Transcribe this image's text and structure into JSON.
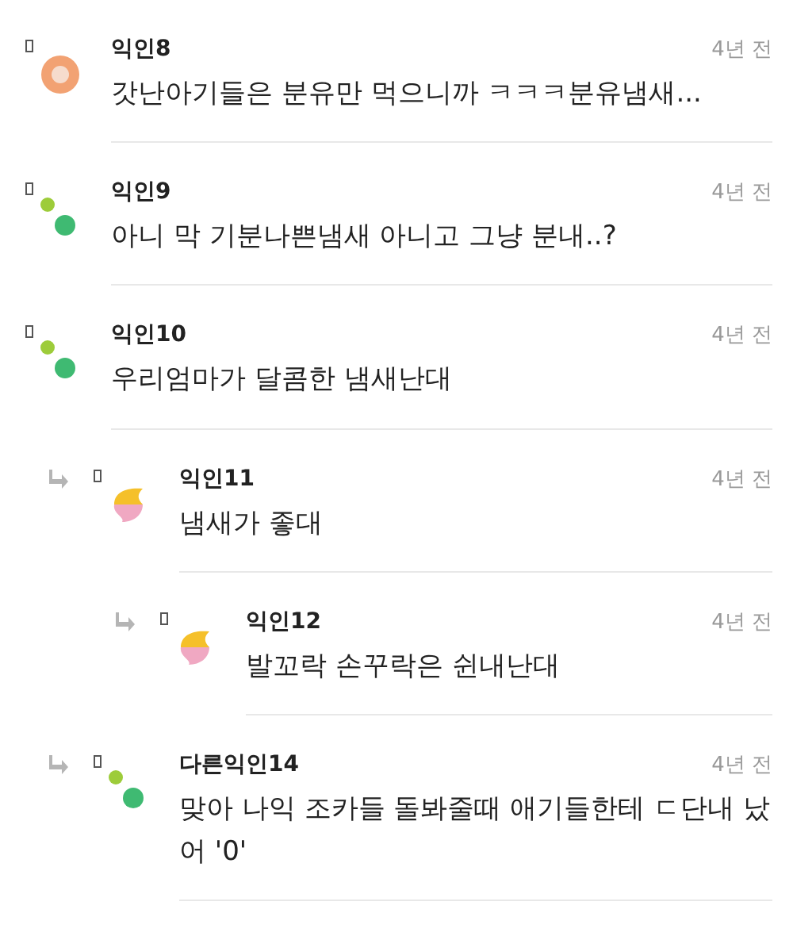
{
  "comments": [
    {
      "author": "익인8",
      "time": "4년 전",
      "text": "갓난아기들은 분유만 먹으니까 ㅋㅋㅋ분유냄새...",
      "kind": "ring"
    },
    {
      "author": "익인9",
      "time": "4년 전",
      "text": "아니 막 기분나쁜냄새 아니고 그냥 분내..?",
      "kind": "dots"
    },
    {
      "author": "익인10",
      "time": "4년 전",
      "text": "우리엄마가 달콤한 냄새난대",
      "kind": "dots",
      "children": [
        {
          "author": "익인11",
          "time": "4년 전",
          "text": "냄새가 좋대",
          "kind": "swirl",
          "children": [
            {
              "author": "익인12",
              "time": "4년 전",
              "text": "발꼬락 손꾸락은 쉰내난대",
              "kind": "swirl"
            }
          ]
        },
        {
          "author": "다른익인14",
          "time": "4년 전",
          "text": "맞아 나익 조카들 돌봐줄때 애기들한테 ㄷ단내 났어 '0'",
          "kind": "dots"
        }
      ]
    }
  ]
}
